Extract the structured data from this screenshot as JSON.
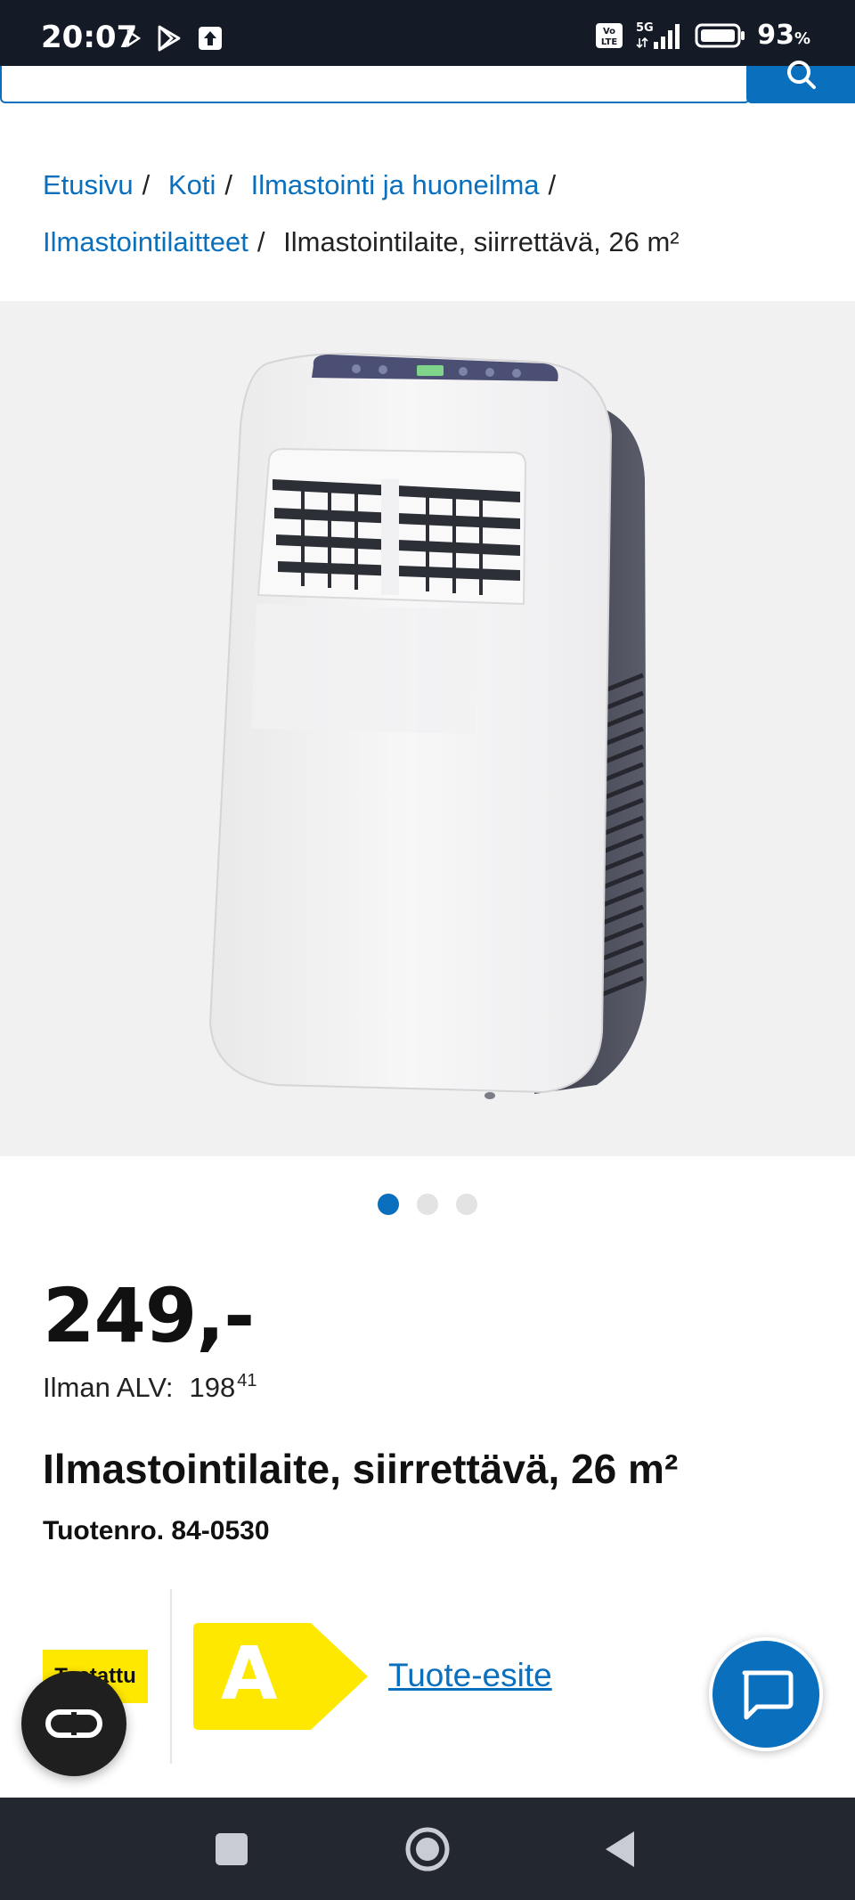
{
  "status_bar": {
    "time": "20:07",
    "battery_pct": "93",
    "battery_unit": "%",
    "network": "5G",
    "volte": "Vo LTE",
    "icons": [
      "play-store-notification-icon",
      "play-icon",
      "upload-icon",
      "volte-icon",
      "signal-icon",
      "battery-icon"
    ]
  },
  "breadcrumb": {
    "items": [
      "Etusivu",
      "Koti",
      "Ilmastointi ja huoneilma",
      "Ilmastointilaitteet"
    ],
    "current": "Ilmastointilaite, siirrettävä, 26 m²"
  },
  "gallery": {
    "image_count": 3,
    "active_index": 0
  },
  "product": {
    "price": "249,-",
    "net_label": "Ilman ALV:",
    "net_int": "198",
    "net_dec": "41",
    "title": "Ilmastointilaite, siirrettävä, 26 m²",
    "sku": "Tuotenro. 84-0530"
  },
  "badges": {
    "tested": "Testattu",
    "energy_class": "A",
    "leaflet": "Tuote-esite"
  },
  "colors": {
    "accent": "#0a6fbd",
    "badge_yellow": "#ffe800",
    "status_bar": "#151b26",
    "nav_bar": "#232730"
  }
}
